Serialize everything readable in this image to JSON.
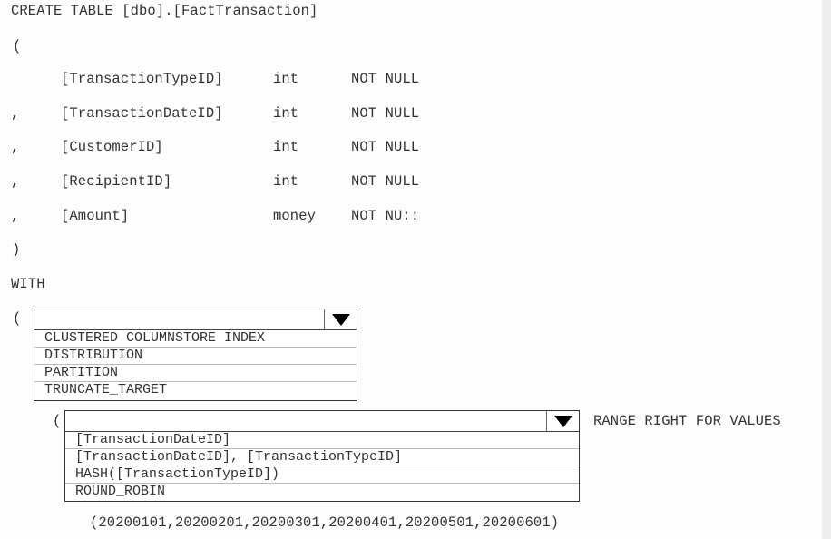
{
  "code": {
    "create_line": "CREATE TABLE [dbo].[FactTransaction]",
    "open_paren": "(",
    "columns": [
      {
        "prefix": "",
        "name": "[TransactionTypeID]",
        "type": "int",
        "constraint": "NOT NULL"
      },
      {
        "prefix": ",",
        "name": "[TransactionDateID]",
        "type": "int",
        "constraint": "NOT NULL"
      },
      {
        "prefix": ",",
        "name": "[CustomerID]",
        "type": "int",
        "constraint": "NOT NULL"
      },
      {
        "prefix": ",",
        "name": "[RecipientID]",
        "type": "int",
        "constraint": "NOT NULL"
      },
      {
        "prefix": ",",
        "name": "[Amount]",
        "type": "money",
        "constraint": "NOT NU::"
      }
    ],
    "close_paren": ")",
    "with_keyword": "WITH",
    "with_open_paren": "(",
    "inner_open_paren": "(",
    "range_text": "RANGE RIGHT FOR VALUES",
    "values_text": "(20200101,20200201,20200301,20200401,20200501,20200601)"
  },
  "dropdown1": {
    "selected": "",
    "options": [
      "CLUSTERED COLUMNSTORE INDEX",
      "DISTRIBUTION",
      "PARTITION",
      "TRUNCATE_TARGET"
    ]
  },
  "dropdown2": {
    "selected": "",
    "options": [
      "[TransactionDateID]",
      "[TransactionDateID], [TransactionTypeID]",
      "HASH([TransactionTypeID])",
      "ROUND_ROBIN"
    ]
  }
}
